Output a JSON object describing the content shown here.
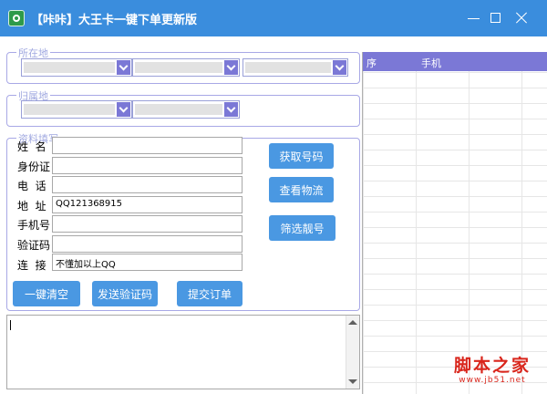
{
  "window": {
    "title": "【咔咔】大王卡一键下单更新版"
  },
  "groups": {
    "location": {
      "legend": "所在地"
    },
    "belong": {
      "legend": "归属地"
    },
    "info": {
      "legend": "资料填写"
    }
  },
  "form": {
    "name_label": "姓  名",
    "id_label": "身份证",
    "phone_label": "电  话",
    "address_label": "地  址",
    "mobile_label": "手机号",
    "code_label": "验证码",
    "link_label": "连  接",
    "name_value": "",
    "id_value": "",
    "phone_value": "",
    "address_value": "QQ121368915",
    "mobile_value": "",
    "code_value": "",
    "link_value": "不懂加以上QQ"
  },
  "buttons": {
    "get_number": "获取号码",
    "check_logistics": "查看物流",
    "filter_number": "筛选靓号",
    "clear_all": "一键清空",
    "send_code": "发送验证码",
    "submit_order": "提交订单"
  },
  "table": {
    "columns": [
      "序",
      "手机"
    ]
  },
  "watermark": {
    "main": "脚本之家",
    "sub": "www.jb51.net"
  },
  "colors": {
    "titlebar": "#3a8ddd",
    "accent": "#7b78d6",
    "button": "#4a98e2",
    "watermark": "#d9261c"
  }
}
